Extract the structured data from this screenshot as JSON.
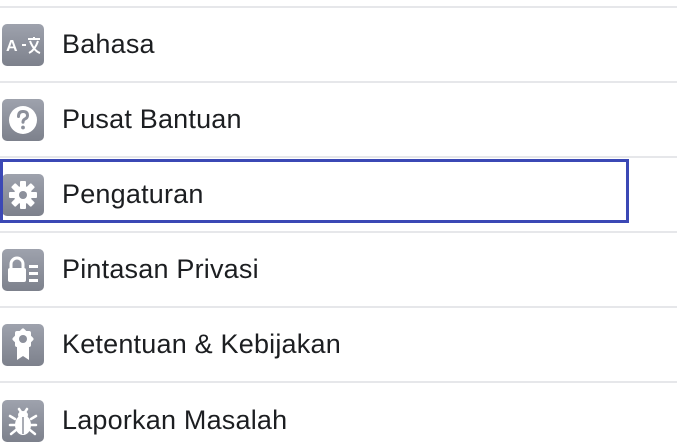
{
  "menu": {
    "items": [
      {
        "label": "Bahasa",
        "icon": "language-icon"
      },
      {
        "label": "Pusat Bantuan",
        "icon": "help-icon"
      },
      {
        "label": "Pengaturan",
        "icon": "gear-icon"
      },
      {
        "label": "Pintasan Privasi",
        "icon": "privacy-lock-icon"
      },
      {
        "label": "Ketentuan & Kebijakan",
        "icon": "ribbon-badge-icon"
      },
      {
        "label": "Laporkan Masalah",
        "icon": "bug-icon"
      }
    ],
    "selected_index": 2
  },
  "colors": {
    "icon_tile": "#8c909b",
    "label_text": "#1c1e21",
    "divider": "#e6e7ea",
    "selection_border": "#3b48b5"
  }
}
